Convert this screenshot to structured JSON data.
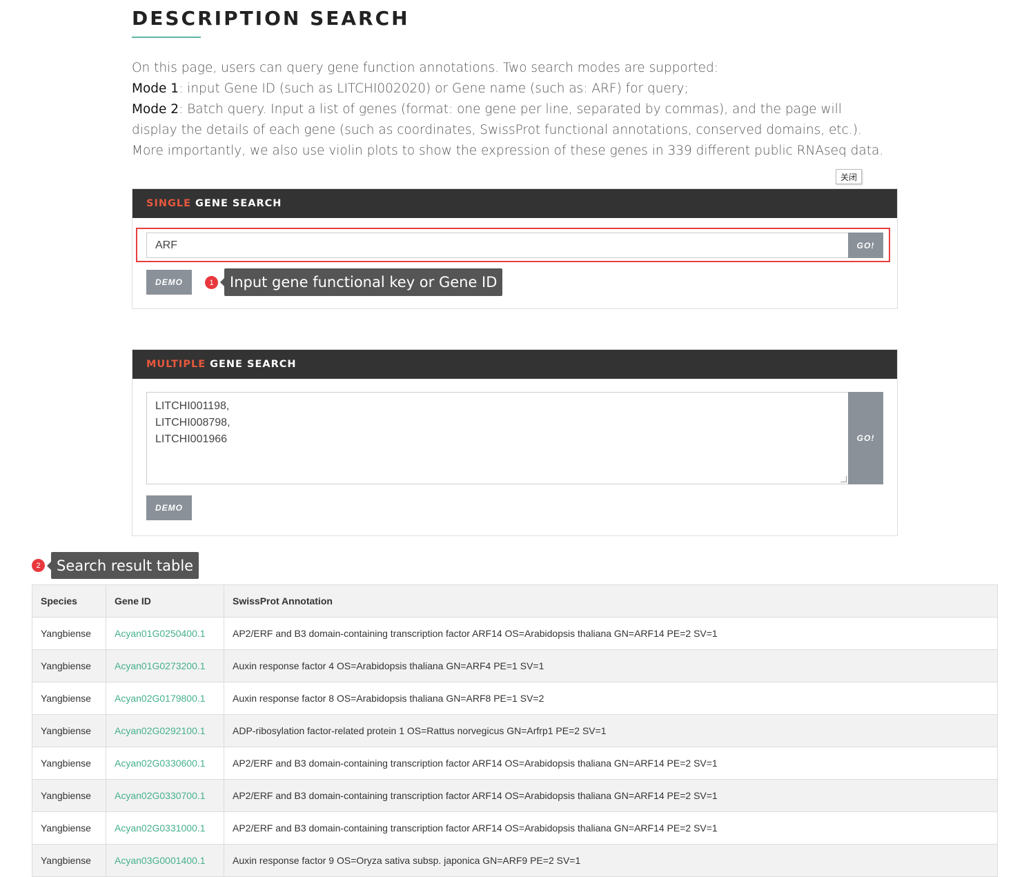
{
  "page": {
    "title": "DESCRIPTION SEARCH",
    "intro_line1": "On this page, users can query gene function annotations. Two search modes are supported:",
    "mode1_label": "Mode 1",
    "mode1_text": ": input Gene ID (such as LITCHI002020) or Gene name (such as: ARF) for query;",
    "mode2_label": "Mode 2",
    "mode2_text": ": Batch query. Input a list of genes (format: one gene per line, separated by commas), and the page will display the details of each gene (such as coordinates, SwissProt functional annotations, conserved domains, etc.). More importantly, we also use violin plots to show the expression of these genes in 339 different public RNAseq data."
  },
  "close_label": "关闭",
  "single": {
    "head_accent": "SINGLE",
    "head_rest": "GENE SEARCH",
    "input_value": "ARF",
    "go_label": "GO!",
    "demo_label": "DEMO",
    "badge": "1",
    "tip": "Input gene functional key or Gene ID"
  },
  "multiple": {
    "head_accent": "MULTIPLE",
    "head_rest": "GENE SEARCH",
    "lines": [
      "LITCHI001198,",
      "LITCHI008798,",
      "LITCHI001966"
    ],
    "go_label": "GO!",
    "demo_label": "DEMO"
  },
  "results": {
    "badge": "2",
    "tip": "Search result table",
    "headers": [
      "Species",
      "Gene ID",
      "SwissProt Annotation"
    ],
    "rows": [
      [
        "Yangbiense",
        "Acyan01G0250400.1",
        "AP2/ERF and B3 domain-containing transcription factor ARF14 OS=Arabidopsis thaliana GN=ARF14 PE=2 SV=1"
      ],
      [
        "Yangbiense",
        "Acyan01G0273200.1",
        "Auxin response factor 4 OS=Arabidopsis thaliana GN=ARF4 PE=1 SV=1"
      ],
      [
        "Yangbiense",
        "Acyan02G0179800.1",
        "Auxin response factor 8 OS=Arabidopsis thaliana GN=ARF8 PE=1 SV=2"
      ],
      [
        "Yangbiense",
        "Acyan02G0292100.1",
        "ADP-ribosylation factor-related protein 1 OS=Rattus norvegicus GN=Arfrp1 PE=2 SV=1"
      ],
      [
        "Yangbiense",
        "Acyan02G0330600.1",
        "AP2/ERF and B3 domain-containing transcription factor ARF14 OS=Arabidopsis thaliana GN=ARF14 PE=2 SV=1"
      ],
      [
        "Yangbiense",
        "Acyan02G0330700.1",
        "AP2/ERF and B3 domain-containing transcription factor ARF14 OS=Arabidopsis thaliana GN=ARF14 PE=2 SV=1"
      ],
      [
        "Yangbiense",
        "Acyan02G0331000.1",
        "AP2/ERF and B3 domain-containing transcription factor ARF14 OS=Arabidopsis thaliana GN=ARF14 PE=2 SV=1"
      ],
      [
        "Yangbiense",
        "Acyan03G0001400.1",
        "Auxin response factor 9 OS=Oryza sativa subsp. japonica GN=ARF9 PE=2 SV=1"
      ]
    ]
  },
  "colors": {
    "accent": "#e8583e",
    "panel_header": "#333333",
    "button": "#8a9199",
    "link": "#45b08c",
    "highlight_border": "#e83e3e",
    "badge": "#e8383d"
  }
}
